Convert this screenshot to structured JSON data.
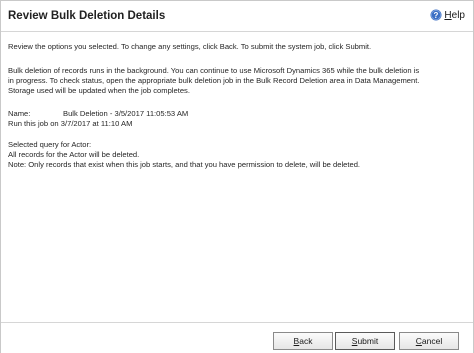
{
  "header": {
    "title": "Review Bulk Deletion Details",
    "help_first_letter": "H",
    "help_rest": "elp",
    "help_icon": "help-circle-icon"
  },
  "content": {
    "intro": "Review the options you selected. To change any settings, click Back. To submit the system job, click Submit.",
    "background_line1": "Bulk deletion of records runs in the background. You can continue to use Microsoft Dynamics 365 while the bulk deletion is",
    "background_line2": "in progress. To check status, open the appropriate bulk deletion job in the Bulk Record Deletion area in Data Management.",
    "background_line3": "Storage used will be updated when the job completes.",
    "name_label": "Name:",
    "name_value": "Bulk Deletion - 3/5/2017 11:05:53 AM",
    "run_line": "Run this job on 3/7/2017 at 11:10 AM",
    "query_heading": "Selected query for Actor:",
    "query_line1": "All records for the Actor will be deleted.",
    "query_note": "Note: Only records that exist when this job starts, and that you have permission to delete, will be deleted."
  },
  "footer": {
    "back_first": "B",
    "back_rest": "ack",
    "submit_first": "S",
    "submit_rest": "ubmit",
    "cancel_first": "C",
    "cancel_rest": "ancel"
  },
  "colors": {
    "help_icon_blue": "#3b6fc4",
    "border": "#c9c9c9"
  }
}
